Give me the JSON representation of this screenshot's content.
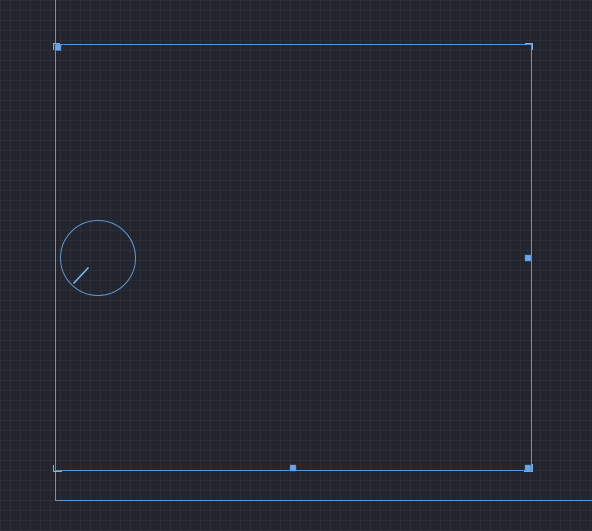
{
  "canvas": {
    "background": "#22252e",
    "grid": true,
    "accent": "#5f95cf",
    "handle_color": "#6aa6ea"
  },
  "selection": {
    "selected": true,
    "resize_handles": [
      "top-left",
      "right-middle",
      "bottom-middle",
      "bottom-right"
    ]
  },
  "component": {
    "icon": "gauge-dial-icon"
  }
}
